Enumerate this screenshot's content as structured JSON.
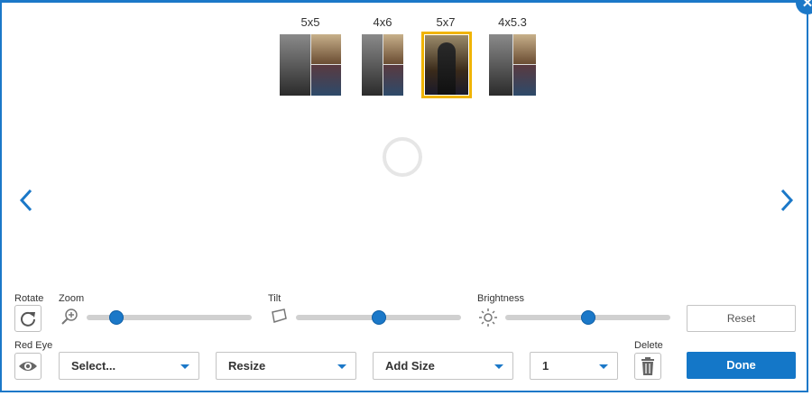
{
  "print_sizes": [
    {
      "label": "5x5",
      "selected": false
    },
    {
      "label": "4x6",
      "selected": false
    },
    {
      "label": "5x7",
      "selected": true
    },
    {
      "label": "4x5.3",
      "selected": false
    }
  ],
  "colors": {
    "accent": "#1b78c8",
    "selected_border": "#f0b400",
    "track": "#d0d0d0"
  },
  "controls": {
    "rotate_label": "Rotate",
    "zoom_label": "Zoom",
    "tilt_label": "Tilt",
    "brightness_label": "Brightness",
    "red_eye_label": "Red Eye",
    "delete_label": "Delete",
    "zoom_level": 0.18,
    "tilt_level": 0.5,
    "brightness_level": 0.5
  },
  "dropdowns": {
    "select": "Select...",
    "resize": "Resize",
    "add_size": "Add Size",
    "quantity": "1"
  },
  "buttons": {
    "reset": "Reset",
    "done": "Done"
  },
  "icons": {
    "close": "close-icon",
    "prev": "chevron-left-icon",
    "next": "chevron-right-icon",
    "rotate": "rotate-icon",
    "zoom": "zoom-icon",
    "tilt": "tilt-icon",
    "brightness": "brightness-icon",
    "red_eye": "eye-icon",
    "delete": "trash-icon"
  }
}
